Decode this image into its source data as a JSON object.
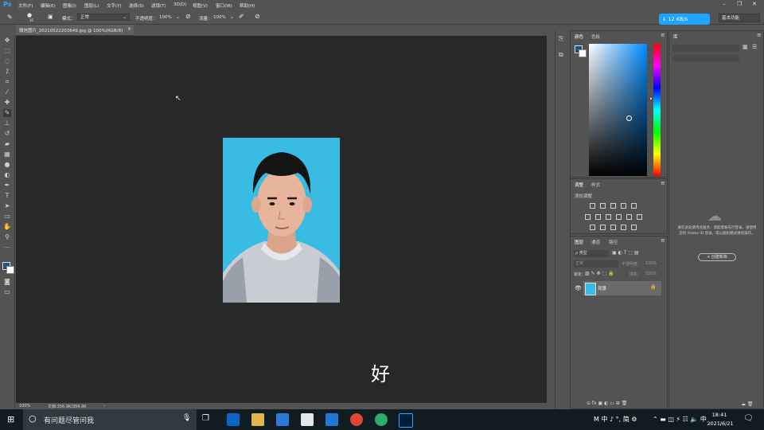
{
  "app": {
    "logo": "Ps"
  },
  "menu": [
    "文件(F)",
    "编辑(E)",
    "图像(I)",
    "图层(L)",
    "文字(Y)",
    "选择(S)",
    "滤镜(T)",
    "3D(D)",
    "视图(V)",
    "窗口(W)",
    "帮助(H)"
  ],
  "options_bar": {
    "brush_size": "35",
    "mode_label": "模式：",
    "mode_value": "正常",
    "opacity_label": "不透明度：",
    "opacity_value": "100%",
    "flow_label": "流量：",
    "flow_value": "100%"
  },
  "network_speed": "↓ 12 KB/s",
  "workspace": "基本功能",
  "document": {
    "tab_title": "微信图片_20210522203649.jpg @ 100%(RGB/8)",
    "zoom": "100%",
    "doc_info": "文档:356.9K/356.9K"
  },
  "subtitle": "好",
  "panels": {
    "color_tabs": [
      "颜色",
      "色板"
    ],
    "adjust_tabs": [
      "调整",
      "样式"
    ],
    "adjust_add_label": "添加调整",
    "layers_tabs": [
      "图层",
      "通道",
      "路径"
    ],
    "layers_kind": "ρ 类型",
    "blend_mode": "正常",
    "opacity_label": "不透明度：",
    "opacity_value": "100%",
    "lock_label": "锁定：",
    "fill_label": "填充：",
    "fill_value": "100%",
    "layer_name": "背景",
    "library_tab": "库",
    "library_message": "要在此处使用此服务，请能需要先行登录。请使用您的 Adobe ID 登录，或以脱机模式继续操作。",
    "library_button": "+ 创建新库"
  },
  "taskbar": {
    "search_placeholder": "有问题尽管问我",
    "ime": "M 中 ♪ °, 简 ⚙",
    "time": "18:41",
    "date": "2021/6/21"
  },
  "colors": {
    "photo_background": "#38bce3",
    "accent_blue": "#1ea5ff"
  }
}
